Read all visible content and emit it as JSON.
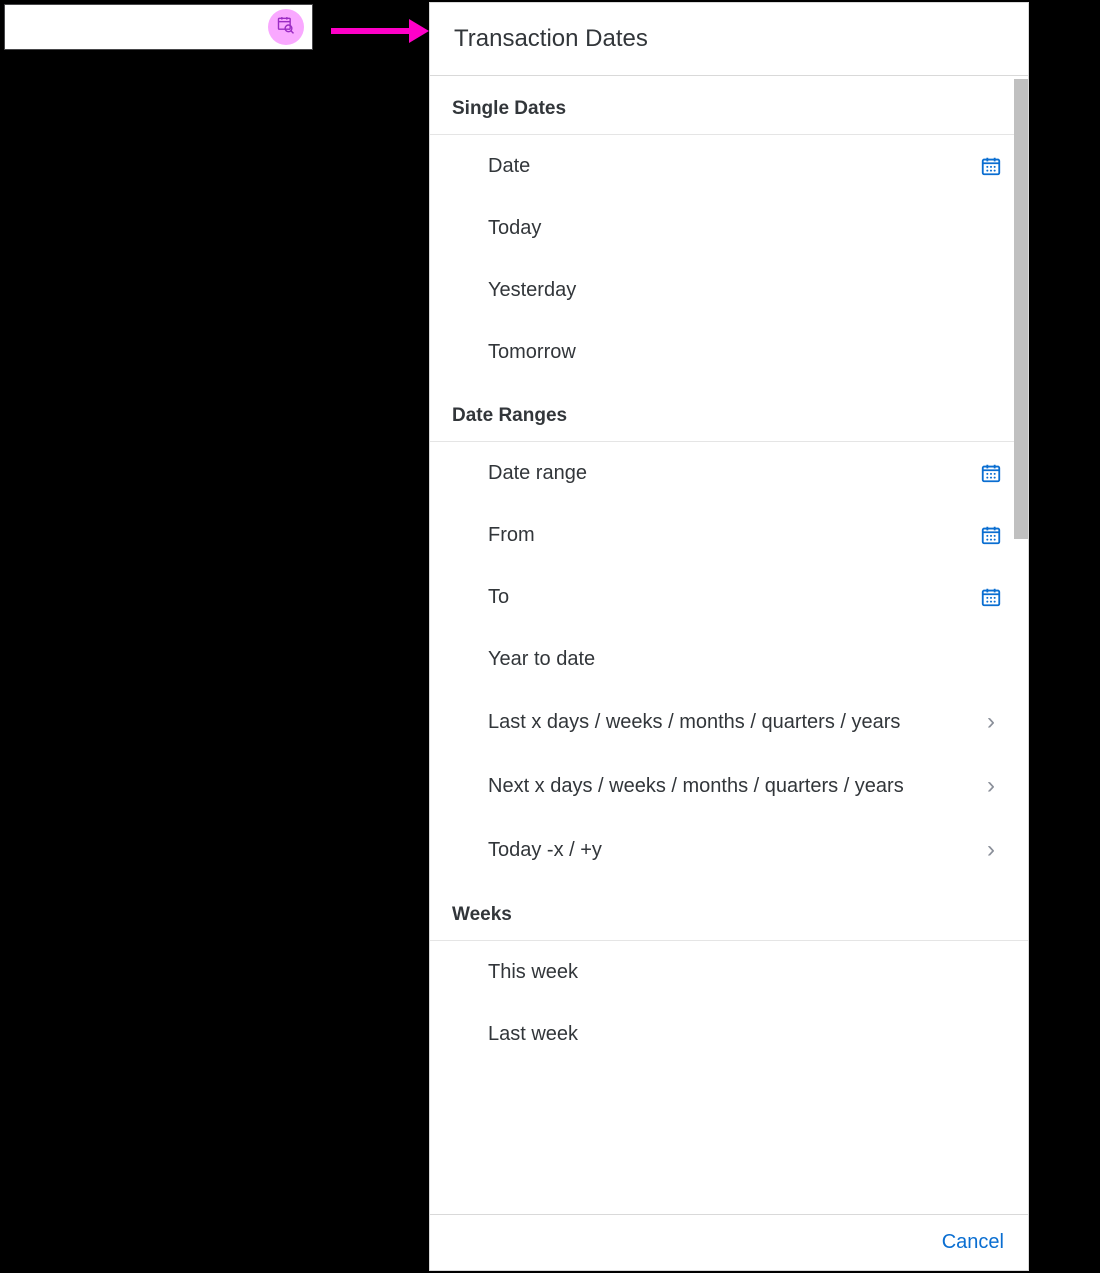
{
  "input": {
    "value": "",
    "placeholder": ""
  },
  "dialog": {
    "title": "Transaction Dates",
    "cancel_label": "Cancel",
    "groups": [
      {
        "header": "Single Dates",
        "items": [
          {
            "label": "Date",
            "icon": "calendar"
          },
          {
            "label": "Today",
            "icon": null
          },
          {
            "label": "Yesterday",
            "icon": null
          },
          {
            "label": "Tomorrow",
            "icon": null
          }
        ]
      },
      {
        "header": "Date Ranges",
        "items": [
          {
            "label": "Date range",
            "icon": "calendar"
          },
          {
            "label": "From",
            "icon": "calendar"
          },
          {
            "label": "To",
            "icon": "calendar"
          },
          {
            "label": "Year to date",
            "icon": null
          },
          {
            "label": "Last x days / weeks / months / quarters / years",
            "icon": "chevron"
          },
          {
            "label": "Next x days / weeks / months / quarters / years",
            "icon": "chevron"
          },
          {
            "label": "Today -x / +y",
            "icon": "chevron"
          }
        ]
      },
      {
        "header": "Weeks",
        "items": [
          {
            "label": "This week",
            "icon": null
          },
          {
            "label": "Last week",
            "icon": null
          }
        ]
      }
    ]
  },
  "colors": {
    "accent": "#0a6ed1",
    "highlight": "#ff00c8",
    "icon_circle": "#f9a8ff"
  }
}
